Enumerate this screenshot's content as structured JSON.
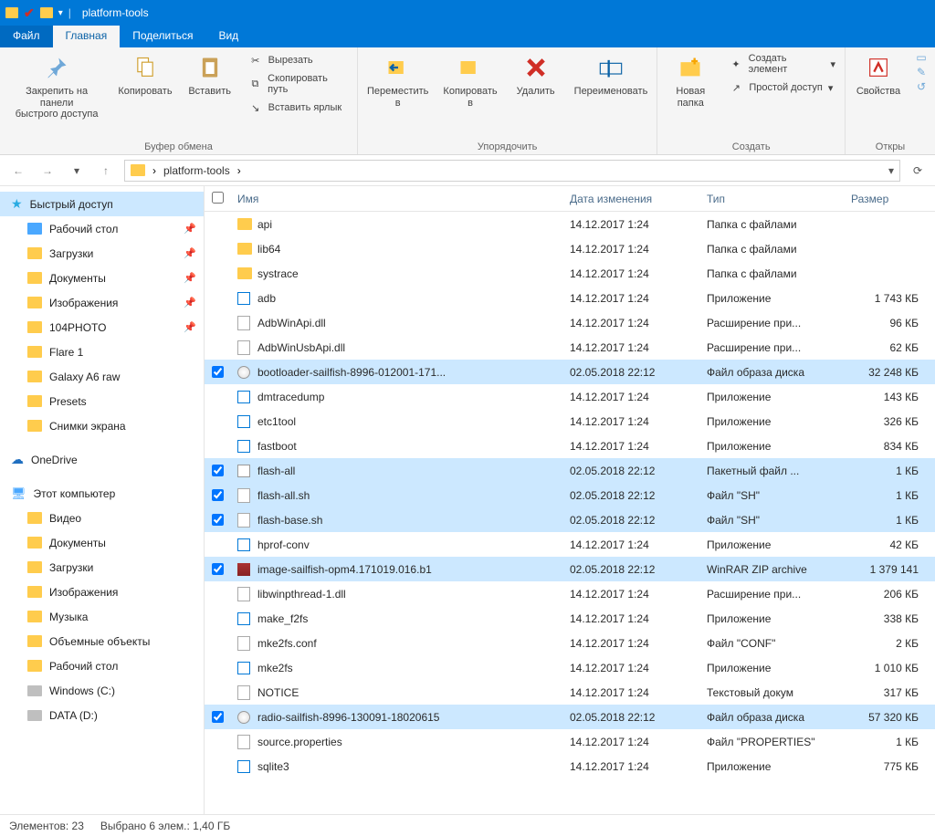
{
  "title": "platform-tools",
  "tabs": {
    "file": "Файл",
    "home": "Главная",
    "share": "Поделиться",
    "view": "Вид"
  },
  "ribbon": {
    "clipboard": {
      "group": "Буфер обмена",
      "pin": "Закрепить на панели\nбыстрого доступа",
      "copy": "Копировать",
      "paste": "Вставить",
      "cut": "Вырезать",
      "copypath": "Скопировать путь",
      "pasteshortcut": "Вставить ярлык"
    },
    "organize": {
      "group": "Упорядочить",
      "move": "Переместить\nв",
      "copy": "Копировать\nв",
      "delete": "Удалить",
      "rename": "Переименовать"
    },
    "create": {
      "group": "Создать",
      "newfolder": "Новая\nпапка",
      "newitem": "Создать элемент",
      "easyaccess": "Простой доступ"
    },
    "open": {
      "group": "Откры",
      "properties": "Свойства"
    }
  },
  "breadcrumb": {
    "item": "platform-tools"
  },
  "sidebar": {
    "quick": "Быстрый доступ",
    "quick_items": [
      {
        "label": "Рабочий стол",
        "pinned": true,
        "color": "blue"
      },
      {
        "label": "Загрузки",
        "pinned": true,
        "color": "yellow"
      },
      {
        "label": "Документы",
        "pinned": true,
        "color": "doc"
      },
      {
        "label": "Изображения",
        "pinned": true,
        "color": "img"
      },
      {
        "label": "104PHOTO",
        "pinned": true,
        "color": "yellow"
      },
      {
        "label": "Flare 1",
        "pinned": false,
        "color": "yellow"
      },
      {
        "label": "Galaxy A6 raw",
        "pinned": false,
        "color": "yellow"
      },
      {
        "label": "Presets",
        "pinned": false,
        "color": "yellow"
      },
      {
        "label": "Снимки экрана",
        "pinned": false,
        "color": "yellow"
      }
    ],
    "onedrive": "OneDrive",
    "thispc": "Этот компьютер",
    "pc_items": [
      {
        "label": "Видео"
      },
      {
        "label": "Документы"
      },
      {
        "label": "Загрузки"
      },
      {
        "label": "Изображения"
      },
      {
        "label": "Музыка"
      },
      {
        "label": "Объемные объекты"
      },
      {
        "label": "Рабочий стол"
      },
      {
        "label": "Windows (C:)"
      },
      {
        "label": "DATA (D:)"
      }
    ]
  },
  "columns": {
    "name": "Имя",
    "date": "Дата изменения",
    "type": "Тип",
    "size": "Размер"
  },
  "files": [
    {
      "name": "api",
      "date": "14.12.2017 1:24",
      "type": "Папка с файлами",
      "size": "",
      "icon": "folder",
      "selected": false
    },
    {
      "name": "lib64",
      "date": "14.12.2017 1:24",
      "type": "Папка с файлами",
      "size": "",
      "icon": "folder",
      "selected": false
    },
    {
      "name": "systrace",
      "date": "14.12.2017 1:24",
      "type": "Папка с файлами",
      "size": "",
      "icon": "folder",
      "selected": false
    },
    {
      "name": "adb",
      "date": "14.12.2017 1:24",
      "type": "Приложение",
      "size": "1 743 КБ",
      "icon": "app",
      "selected": false
    },
    {
      "name": "AdbWinApi.dll",
      "date": "14.12.2017 1:24",
      "type": "Расширение при...",
      "size": "96 КБ",
      "icon": "file",
      "selected": false
    },
    {
      "name": "AdbWinUsbApi.dll",
      "date": "14.12.2017 1:24",
      "type": "Расширение при...",
      "size": "62 КБ",
      "icon": "file",
      "selected": false
    },
    {
      "name": "bootloader-sailfish-8996-012001-171...",
      "date": "02.05.2018 22:12",
      "type": "Файл образа диска",
      "size": "32 248 КБ",
      "icon": "disc",
      "selected": true
    },
    {
      "name": "dmtracedump",
      "date": "14.12.2017 1:24",
      "type": "Приложение",
      "size": "143 КБ",
      "icon": "app",
      "selected": false
    },
    {
      "name": "etc1tool",
      "date": "14.12.2017 1:24",
      "type": "Приложение",
      "size": "326 КБ",
      "icon": "app",
      "selected": false
    },
    {
      "name": "fastboot",
      "date": "14.12.2017 1:24",
      "type": "Приложение",
      "size": "834 КБ",
      "icon": "app",
      "selected": false
    },
    {
      "name": "flash-all",
      "date": "02.05.2018 22:12",
      "type": "Пакетный файл ...",
      "size": "1 КБ",
      "icon": "bat",
      "selected": true
    },
    {
      "name": "flash-all.sh",
      "date": "02.05.2018 22:12",
      "type": "Файл \"SH\"",
      "size": "1 КБ",
      "icon": "file",
      "selected": true
    },
    {
      "name": "flash-base.sh",
      "date": "02.05.2018 22:12",
      "type": "Файл \"SH\"",
      "size": "1 КБ",
      "icon": "file",
      "selected": true
    },
    {
      "name": "hprof-conv",
      "date": "14.12.2017 1:24",
      "type": "Приложение",
      "size": "42 КБ",
      "icon": "app",
      "selected": false
    },
    {
      "name": "image-sailfish-opm4.171019.016.b1",
      "date": "02.05.2018 22:12",
      "type": "WinRAR ZIP archive",
      "size": "1 379 141",
      "icon": "rar",
      "selected": true
    },
    {
      "name": "libwinpthread-1.dll",
      "date": "14.12.2017 1:24",
      "type": "Расширение при...",
      "size": "206 КБ",
      "icon": "file",
      "selected": false
    },
    {
      "name": "make_f2fs",
      "date": "14.12.2017 1:24",
      "type": "Приложение",
      "size": "338 КБ",
      "icon": "app",
      "selected": false
    },
    {
      "name": "mke2fs.conf",
      "date": "14.12.2017 1:24",
      "type": "Файл \"CONF\"",
      "size": "2 КБ",
      "icon": "file",
      "selected": false
    },
    {
      "name": "mke2fs",
      "date": "14.12.2017 1:24",
      "type": "Приложение",
      "size": "1 010 КБ",
      "icon": "app",
      "selected": false
    },
    {
      "name": "NOTICE",
      "date": "14.12.2017 1:24",
      "type": "Текстовый докум",
      "size": "317 КБ",
      "icon": "file",
      "selected": false
    },
    {
      "name": "radio-sailfish-8996-130091-18020615",
      "date": "02.05.2018 22:12",
      "type": "Файл образа диска",
      "size": "57 320 КБ",
      "icon": "disc",
      "selected": true
    },
    {
      "name": "source.properties",
      "date": "14.12.2017 1:24",
      "type": "Файл \"PROPERTIES\"",
      "size": "1 КБ",
      "icon": "file",
      "selected": false
    },
    {
      "name": "sqlite3",
      "date": "14.12.2017 1:24",
      "type": "Приложение",
      "size": "775 КБ",
      "icon": "app",
      "selected": false
    }
  ],
  "status": {
    "items": "Элементов: 23",
    "selected": "Выбрано 6 элем.: 1,40 ГБ"
  }
}
